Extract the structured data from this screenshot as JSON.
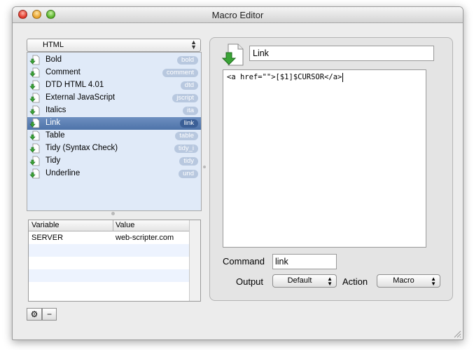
{
  "window": {
    "title": "Macro Editor"
  },
  "category_popup": {
    "value": "HTML"
  },
  "macros": [
    {
      "name": "Bold",
      "badge": "bold"
    },
    {
      "name": "Comment",
      "badge": "comment"
    },
    {
      "name": "DTD HTML 4.01",
      "badge": "dtd"
    },
    {
      "name": "External JavaScript",
      "badge": "jscript"
    },
    {
      "name": "Italics",
      "badge": "ita"
    },
    {
      "name": "Link",
      "badge": "link"
    },
    {
      "name": "Table",
      "badge": "table"
    },
    {
      "name": "Tidy (Syntax Check)",
      "badge": "tidy_i"
    },
    {
      "name": "Tidy",
      "badge": "tidy"
    },
    {
      "name": "Underline",
      "badge": "und"
    }
  ],
  "selected_index": 5,
  "variables": {
    "col_variable": "Variable",
    "col_value": "Value",
    "rows": [
      {
        "variable": "SERVER",
        "value": "web-scripter.com"
      }
    ]
  },
  "editor": {
    "name": "Link",
    "code": "<a href=\"\">[$1]$CURSOR</a>",
    "command_label": "Command",
    "command": "link",
    "output_label": "Output",
    "output": "Default",
    "action_label": "Action",
    "action": "Macro"
  },
  "buttons": {
    "gear": "⚙",
    "remove": "−"
  },
  "colors": {
    "selection": "#4e73a9",
    "list_bg": "#e0eaf8",
    "badge": "#b8c8df",
    "icon_green": "#3aa336"
  }
}
